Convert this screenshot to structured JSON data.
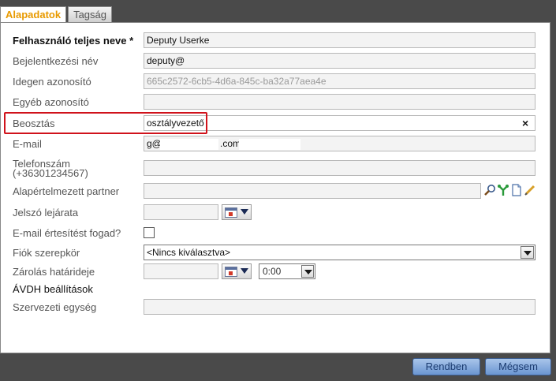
{
  "tabs": [
    {
      "label": "Alapadatok",
      "active": true
    },
    {
      "label": "Tagság",
      "active": false
    }
  ],
  "fields": {
    "full_name": {
      "label": "Felhasználó teljes neve *",
      "value": "Deputy Userke"
    },
    "login": {
      "label": "Bejelentkezési név",
      "value": "deputy@"
    },
    "foreign_id": {
      "label": "Idegen azonosító",
      "value": "665c2572-6cb5-4d6a-845c-ba32a77aea4e"
    },
    "other_id": {
      "label": "Egyéb azonosító",
      "value": ""
    },
    "position": {
      "label": "Beosztás",
      "value": "osztályvezető",
      "clear_symbol": "×"
    },
    "email": {
      "label": "E-mail",
      "value_prefix": "g@",
      "value_suffix": ".com"
    },
    "phone": {
      "label_line1": "Telefonszám",
      "label_line2": "(+36301234567)",
      "value": ""
    },
    "default_partner": {
      "label": "Alapértelmezett partner",
      "value": "",
      "icons": [
        "search-icon",
        "branch-icon",
        "document-icon",
        "edit-pencil-icon"
      ]
    },
    "password_expiry": {
      "label": "Jelszó lejárata",
      "value": ""
    },
    "email_notify": {
      "label": "E-mail értesítést fogad?",
      "checked": false
    },
    "account_role": {
      "label": "Fiók szerepkör",
      "selected": "<Nincs kiválasztva>"
    },
    "lock_deadline": {
      "label": "Zárolás határideje",
      "date": "",
      "time": "0:00"
    },
    "avdh": {
      "label": "ÁVDH beállítások"
    },
    "org_unit": {
      "label": "Szervezeti egység",
      "value": ""
    }
  },
  "buttons": {
    "ok": "Rendben",
    "cancel": "Mégsem"
  },
  "colors": {
    "active_tab_text": "#e89a00",
    "highlight_border": "#d0121b",
    "button_bg": "#7aa1d8",
    "background": "#4a4a4a"
  }
}
